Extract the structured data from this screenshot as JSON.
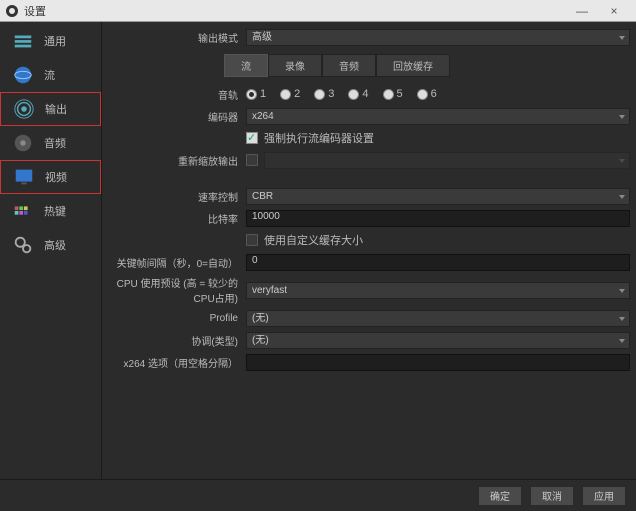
{
  "window": {
    "title": "设置",
    "min": "—",
    "close": "×"
  },
  "sidebar": {
    "items": [
      {
        "label": "通用"
      },
      {
        "label": "流"
      },
      {
        "label": "输出"
      },
      {
        "label": "音频"
      },
      {
        "label": "视频"
      },
      {
        "label": "热键"
      },
      {
        "label": "高级"
      }
    ]
  },
  "header": {
    "modeLabel": "输出模式",
    "modeValue": "高级"
  },
  "tabs": {
    "stream": "流",
    "record": "录像",
    "audio": "音频",
    "replay": "回放缓存"
  },
  "fields": {
    "tracksLabel": "音轨",
    "tracks": [
      "1",
      "2",
      "3",
      "4",
      "5",
      "6"
    ],
    "encoderLabel": "编码器",
    "encoderValue": "x264",
    "enforceLabel": "强制执行流编码器设置",
    "rescaleLabel": "重新缩放输出",
    "rateCtrlLabel": "速率控制",
    "rateCtrlValue": "CBR",
    "bitrateLabel": "比特率",
    "bitrateValue": "10000",
    "customBufLabel": "使用自定义缓存大小",
    "keyintLabel": "关键帧间隔（秒，0=自动）",
    "keyintValue": "0",
    "cpuLabel": "CPU 使用预设 (高 = 较少的 CPU占用)",
    "cpuValue": "veryfast",
    "profileLabel": "Profile",
    "profileValue": "(无)",
    "tuneLabel": "协调(类型)",
    "tuneValue": "(无)",
    "x264Label": "x264 选项（用空格分隔）",
    "x264Value": ""
  },
  "footer": {
    "ok": "确定",
    "cancel": "取消",
    "apply": "应用"
  }
}
